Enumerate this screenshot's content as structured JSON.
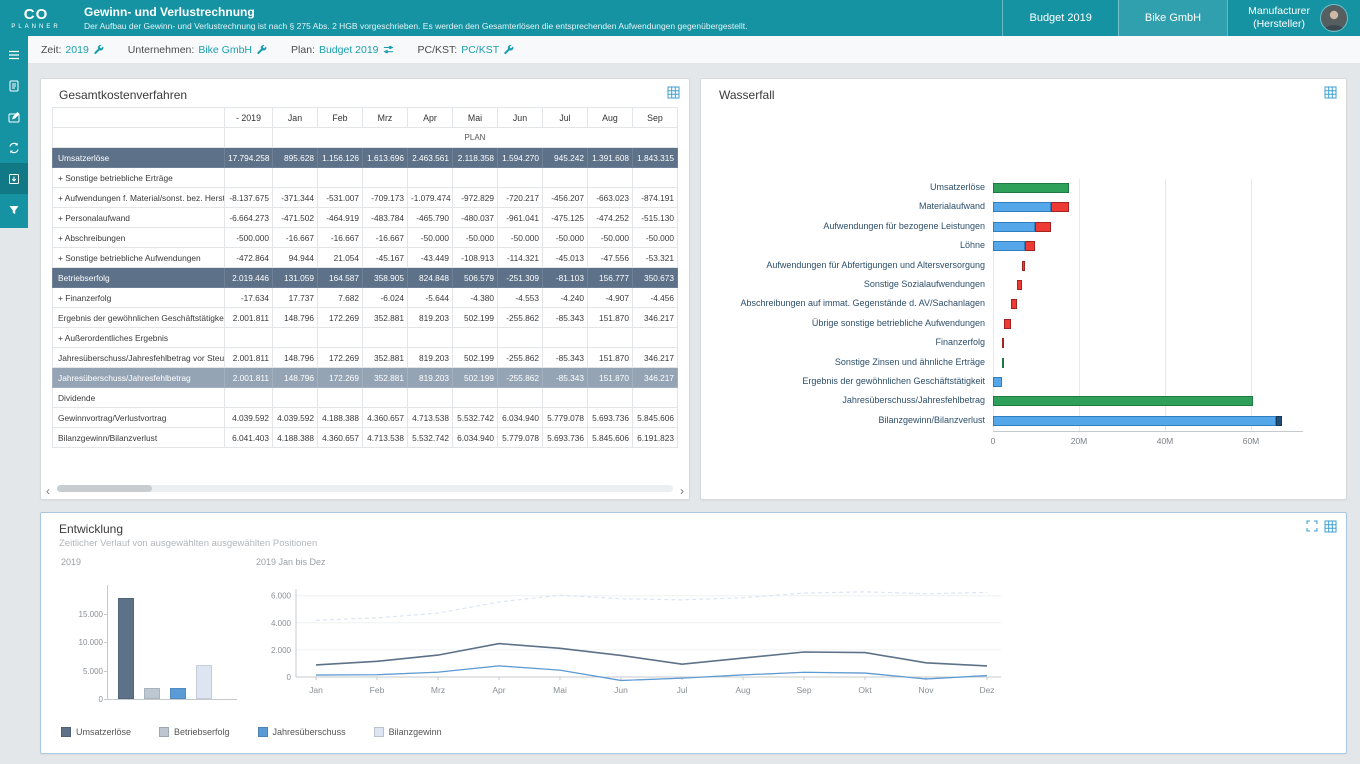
{
  "app": {
    "background": "#e4e7e9",
    "accent": "#1593a3",
    "link_color": "#1c9fb0"
  },
  "header": {
    "logo_line1": "CO",
    "logo_line2": "PLANNER",
    "title": "Gewinn- und Verlustrechnung",
    "subtitle": "Der Aufbau der Gewinn- und Verlustrechnung ist nach § 275 Abs. 2 HGB vorgeschrieben. Es werden den Gesamterlösen die entsprechenden Aufwendungen gegenübergestellt.",
    "buttons": [
      {
        "label": "Budget 2019"
      },
      {
        "label": "Bike GmbH"
      },
      {
        "label": "Manufacturer",
        "sublabel": "(Hersteller)"
      }
    ]
  },
  "sidebar": {
    "icons": [
      "menu-icon",
      "report-icon",
      "edit-icon",
      "sync-icon",
      "export-icon",
      "filter-icon"
    ]
  },
  "filters": [
    {
      "label": "Zeit:",
      "value": "2019",
      "icon": "wrench"
    },
    {
      "label": "Unternehmen:",
      "value": "Bike GmbH",
      "icon": "wrench"
    },
    {
      "label": "Plan:",
      "value": "Budget 2019",
      "icon": "sliders"
    },
    {
      "label": "PC/KST:",
      "value": "PC/KST",
      "icon": "wrench"
    }
  ],
  "gkv": {
    "title": "Gesamtkostenverfahren",
    "scenario_label": "PLAN",
    "columns": [
      "- 2019",
      "Jan",
      "Feb",
      "Mrz",
      "Apr",
      "Mai",
      "Jun",
      "Jul",
      "Aug",
      "Sep"
    ],
    "rows": [
      {
        "label": "Umsatzerlöse",
        "style": "dark",
        "values": [
          "17.794.258",
          "895.628",
          "1.156.126",
          "1.613.696",
          "2.463.561",
          "2.118.358",
          "1.594.270",
          "945.242",
          "1.391.608",
          "1.843.315"
        ]
      },
      {
        "label": "+ Sonstige betriebliche Erträge",
        "style": "normal",
        "values": [
          "",
          "",
          "",
          "",
          "",
          "",
          "",
          "",
          "",
          ""
        ]
      },
      {
        "label": "+ Aufwendungen f. Material/sonst. bez. Herstellu",
        "style": "normal",
        "values": [
          "-8.137.675",
          "-371.344",
          "-531.007",
          "-709.173",
          "-1.079.474",
          "-972.829",
          "-720.217",
          "-456.207",
          "-663.023",
          "-874.191"
        ]
      },
      {
        "label": "+ Personalaufwand",
        "style": "normal",
        "values": [
          "-6.664.273",
          "-471.502",
          "-464.919",
          "-483.784",
          "-465.790",
          "-480.037",
          "-961.041",
          "-475.125",
          "-474.252",
          "-515.130"
        ]
      },
      {
        "label": "+ Abschreibungen",
        "style": "normal",
        "values": [
          "-500.000",
          "-16.667",
          "-16.667",
          "-16.667",
          "-50.000",
          "-50.000",
          "-50.000",
          "-50.000",
          "-50.000",
          "-50.000"
        ]
      },
      {
        "label": "+ Sonstige betriebliche Aufwendungen",
        "style": "normal",
        "values": [
          "-472.864",
          "94.944",
          "21.054",
          "-45.167",
          "-43.449",
          "-108.913",
          "-114.321",
          "-45.013",
          "-47.556",
          "-53.321"
        ]
      },
      {
        "label": "Betriebserfolg",
        "style": "dark",
        "values": [
          "2.019.446",
          "131.059",
          "164.587",
          "358.905",
          "824.848",
          "506.579",
          "-251.309",
          "-81.103",
          "156.777",
          "350.673"
        ]
      },
      {
        "label": "+ Finanzerfolg",
        "style": "normal",
        "values": [
          "-17.634",
          "17.737",
          "7.682",
          "-6.024",
          "-5.644",
          "-4.380",
          "-4.553",
          "-4.240",
          "-4.907",
          "-4.456"
        ]
      },
      {
        "label": "Ergebnis der gewöhnlichen Geschäftstätigkeit",
        "style": "normal",
        "values": [
          "2.001.811",
          "148.796",
          "172.269",
          "352.881",
          "819.203",
          "502.199",
          "-255.862",
          "-85.343",
          "151.870",
          "346.217"
        ]
      },
      {
        "label": "+ Außerordentliches Ergebnis",
        "style": "normal",
        "values": [
          "",
          "",
          "",
          "",
          "",
          "",
          "",
          "",
          "",
          ""
        ]
      },
      {
        "label": "Jahresüberschuss/Jahresfehlbetrag vor Steuern",
        "style": "normal",
        "values": [
          "2.001.811",
          "148.796",
          "172.269",
          "352.881",
          "819.203",
          "502.199",
          "-255.862",
          "-85.343",
          "151.870",
          "346.217"
        ]
      },
      {
        "label": "Jahresüberschuss/Jahresfehlbetrag",
        "style": "medium",
        "values": [
          "2.001.811",
          "148.796",
          "172.269",
          "352.881",
          "819.203",
          "502.199",
          "-255.862",
          "-85.343",
          "151.870",
          "346.217"
        ]
      },
      {
        "label": "Dividende",
        "style": "normal",
        "values": [
          "",
          "",
          "",
          "",
          "",
          "",
          "",
          "",
          "",
          ""
        ]
      },
      {
        "label": "Gewinnvortrag/Verlustvortrag",
        "style": "normal",
        "values": [
          "4.039.592",
          "4.039.592",
          "4.188.388",
          "4.360.657",
          "4.713.538",
          "5.532.742",
          "6.034.940",
          "5.779.078",
          "5.693.736",
          "5.845.606"
        ]
      },
      {
        "label": "Bilanzgewinn/Bilanzverlust",
        "style": "normal",
        "values": [
          "6.041.403",
          "4.188.388",
          "4.360.657",
          "4.713.538",
          "5.532.742",
          "6.034.940",
          "5.779.078",
          "5.693.736",
          "5.845.606",
          "6.191.823"
        ]
      }
    ]
  },
  "waterfall": {
    "title": "Wasserfall",
    "colors": {
      "green": "#2fa05a",
      "red": "#ee3a34",
      "blue": "#54a7e8",
      "navy": "#1f4e79"
    }
  },
  "entwicklung": {
    "title": "Entwicklung",
    "subtitle": "Zeitlicher Verlauf von ausgewählten ausgewählten Positionen",
    "bar_title": "2019",
    "line_title": "2019 Jan bis Dez",
    "legend": [
      {
        "label": "Umsatzerlöse",
        "color": "#5d7189"
      },
      {
        "label": "Betriebserfolg",
        "color": "#bcc7d1"
      },
      {
        "label": "Jahresüberschuss",
        "color": "#5b9bd5"
      },
      {
        "label": "Bilanzgewinn",
        "color": "#dde4f2"
      }
    ]
  },
  "chart_data": [
    {
      "id": "waterfall",
      "type": "bar",
      "subtype": "waterfall",
      "orientation": "horizontal",
      "title": "Wasserfall",
      "unit": "millions",
      "xticks": [
        {
          "label": "0",
          "value": 0
        },
        {
          "label": "20M",
          "value": 20
        },
        {
          "label": "40M",
          "value": 40
        },
        {
          "label": "60M",
          "value": 60
        }
      ],
      "xmax": 72,
      "bars": [
        {
          "label": "Umsatzerlöse",
          "segments": [
            {
              "from": 0,
              "to": 17.79,
              "color": "green"
            }
          ]
        },
        {
          "label": "Materialaufwand",
          "segments": [
            {
              "from": 0,
              "to": 13.4,
              "color": "blue"
            },
            {
              "from": 13.4,
              "to": 17.79,
              "color": "red"
            }
          ]
        },
        {
          "label": "Aufwendungen für bezogene Leistungen",
          "segments": [
            {
              "from": 0,
              "to": 9.66,
              "color": "blue"
            },
            {
              "from": 9.66,
              "to": 13.4,
              "color": "red"
            }
          ]
        },
        {
          "label": "Löhne",
          "segments": [
            {
              "from": 0,
              "to": 7.4,
              "color": "blue"
            },
            {
              "from": 7.4,
              "to": 9.66,
              "color": "red"
            }
          ]
        },
        {
          "label": "Aufwendungen für Abfertigungen und Altersversorgung",
          "segments": [
            {
              "from": 6.8,
              "to": 7.4,
              "color": "red"
            }
          ]
        },
        {
          "label": "Sonstige Sozialaufwendungen",
          "segments": [
            {
              "from": 5.6,
              "to": 6.8,
              "color": "red"
            }
          ]
        },
        {
          "label": "Abschreibungen auf immat. Gegenstände d. AV/Sachanlagen",
          "segments": [
            {
              "from": 4.2,
              "to": 5.6,
              "color": "red"
            }
          ]
        },
        {
          "label": "Übrige sonstige betriebliche Aufwendungen",
          "segments": [
            {
              "from": 2.6,
              "to": 4.2,
              "color": "red"
            }
          ]
        },
        {
          "label": "Finanzerfolg",
          "segments": [
            {
              "from": 2.2,
              "to": 2.6,
              "color": "red"
            }
          ]
        },
        {
          "label": "Sonstige Zinsen und ähnliche Erträge",
          "segments": [
            {
              "from": 2.0,
              "to": 2.4,
              "color": "green"
            }
          ]
        },
        {
          "label": "Ergebnis der gewöhnlichen Geschäftstätigkeit",
          "segments": [
            {
              "from": 0,
              "to": 2.0,
              "color": "blue"
            }
          ]
        },
        {
          "label": "Jahresüberschuss/Jahresfehlbetrag",
          "segments": [
            {
              "from": 0,
              "to": 60.5,
              "color": "green"
            }
          ]
        },
        {
          "label": "Bilanzgewinn/Bilanzverlust",
          "segments": [
            {
              "from": 0,
              "to": 65.8,
              "color": "blue"
            },
            {
              "from": 65.8,
              "to": 67.3,
              "color": "navy"
            }
          ]
        }
      ]
    },
    {
      "id": "entwicklung-bar",
      "type": "bar",
      "title": "2019",
      "categories": [
        "Umsatzerlöse",
        "Betriebserfolg",
        "Jahresüberschuss",
        "Bilanzgewinn"
      ],
      "values": [
        17794,
        2019,
        2002,
        6041
      ],
      "yticks": [
        {
          "label": "0",
          "value": 0
        },
        {
          "label": "5.000",
          "value": 5000
        },
        {
          "label": "10.000",
          "value": 10000
        },
        {
          "label": "15.000",
          "value": 15000
        }
      ],
      "ylim": [
        0,
        19000
      ]
    },
    {
      "id": "entwicklung-line",
      "type": "line",
      "title": "2019 Jan bis Dez",
      "x": [
        "Jan",
        "Feb",
        "Mrz",
        "Apr",
        "Mai",
        "Jun",
        "Jul",
        "Aug",
        "Sep",
        "Okt",
        "Nov",
        "Dez"
      ],
      "series": [
        {
          "name": "Umsatzerlöse",
          "color": "#5d7189",
          "values": [
            896,
            1156,
            1614,
            2464,
            2118,
            1594,
            945,
            1392,
            1843,
            1800,
            1050,
            820
          ]
        },
        {
          "name": "Betriebserfolg",
          "color": "#bcc7d1",
          "values": [
            131,
            165,
            359,
            825,
            507,
            -251,
            -81,
            157,
            351,
            300,
            -140,
            110
          ]
        },
        {
          "name": "Jahresüberschuss",
          "color": "#5b9bd5",
          "values": [
            149,
            172,
            353,
            819,
            502,
            -256,
            -85,
            152,
            346,
            290,
            -150,
            100
          ]
        },
        {
          "name": "Bilanzgewinn",
          "color": "#dde4f2",
          "values": [
            4188,
            4361,
            4714,
            5533,
            6035,
            5779,
            5694,
            5846,
            6192,
            6290,
            6140,
            6240
          ]
        }
      ],
      "yticks": [
        {
          "label": "0",
          "value": 0
        },
        {
          "label": "2.000",
          "value": 2000
        },
        {
          "label": "4.000",
          "value": 4000
        },
        {
          "label": "6.000",
          "value": 6000
        }
      ],
      "ylim": [
        -400,
        6800
      ]
    }
  ]
}
